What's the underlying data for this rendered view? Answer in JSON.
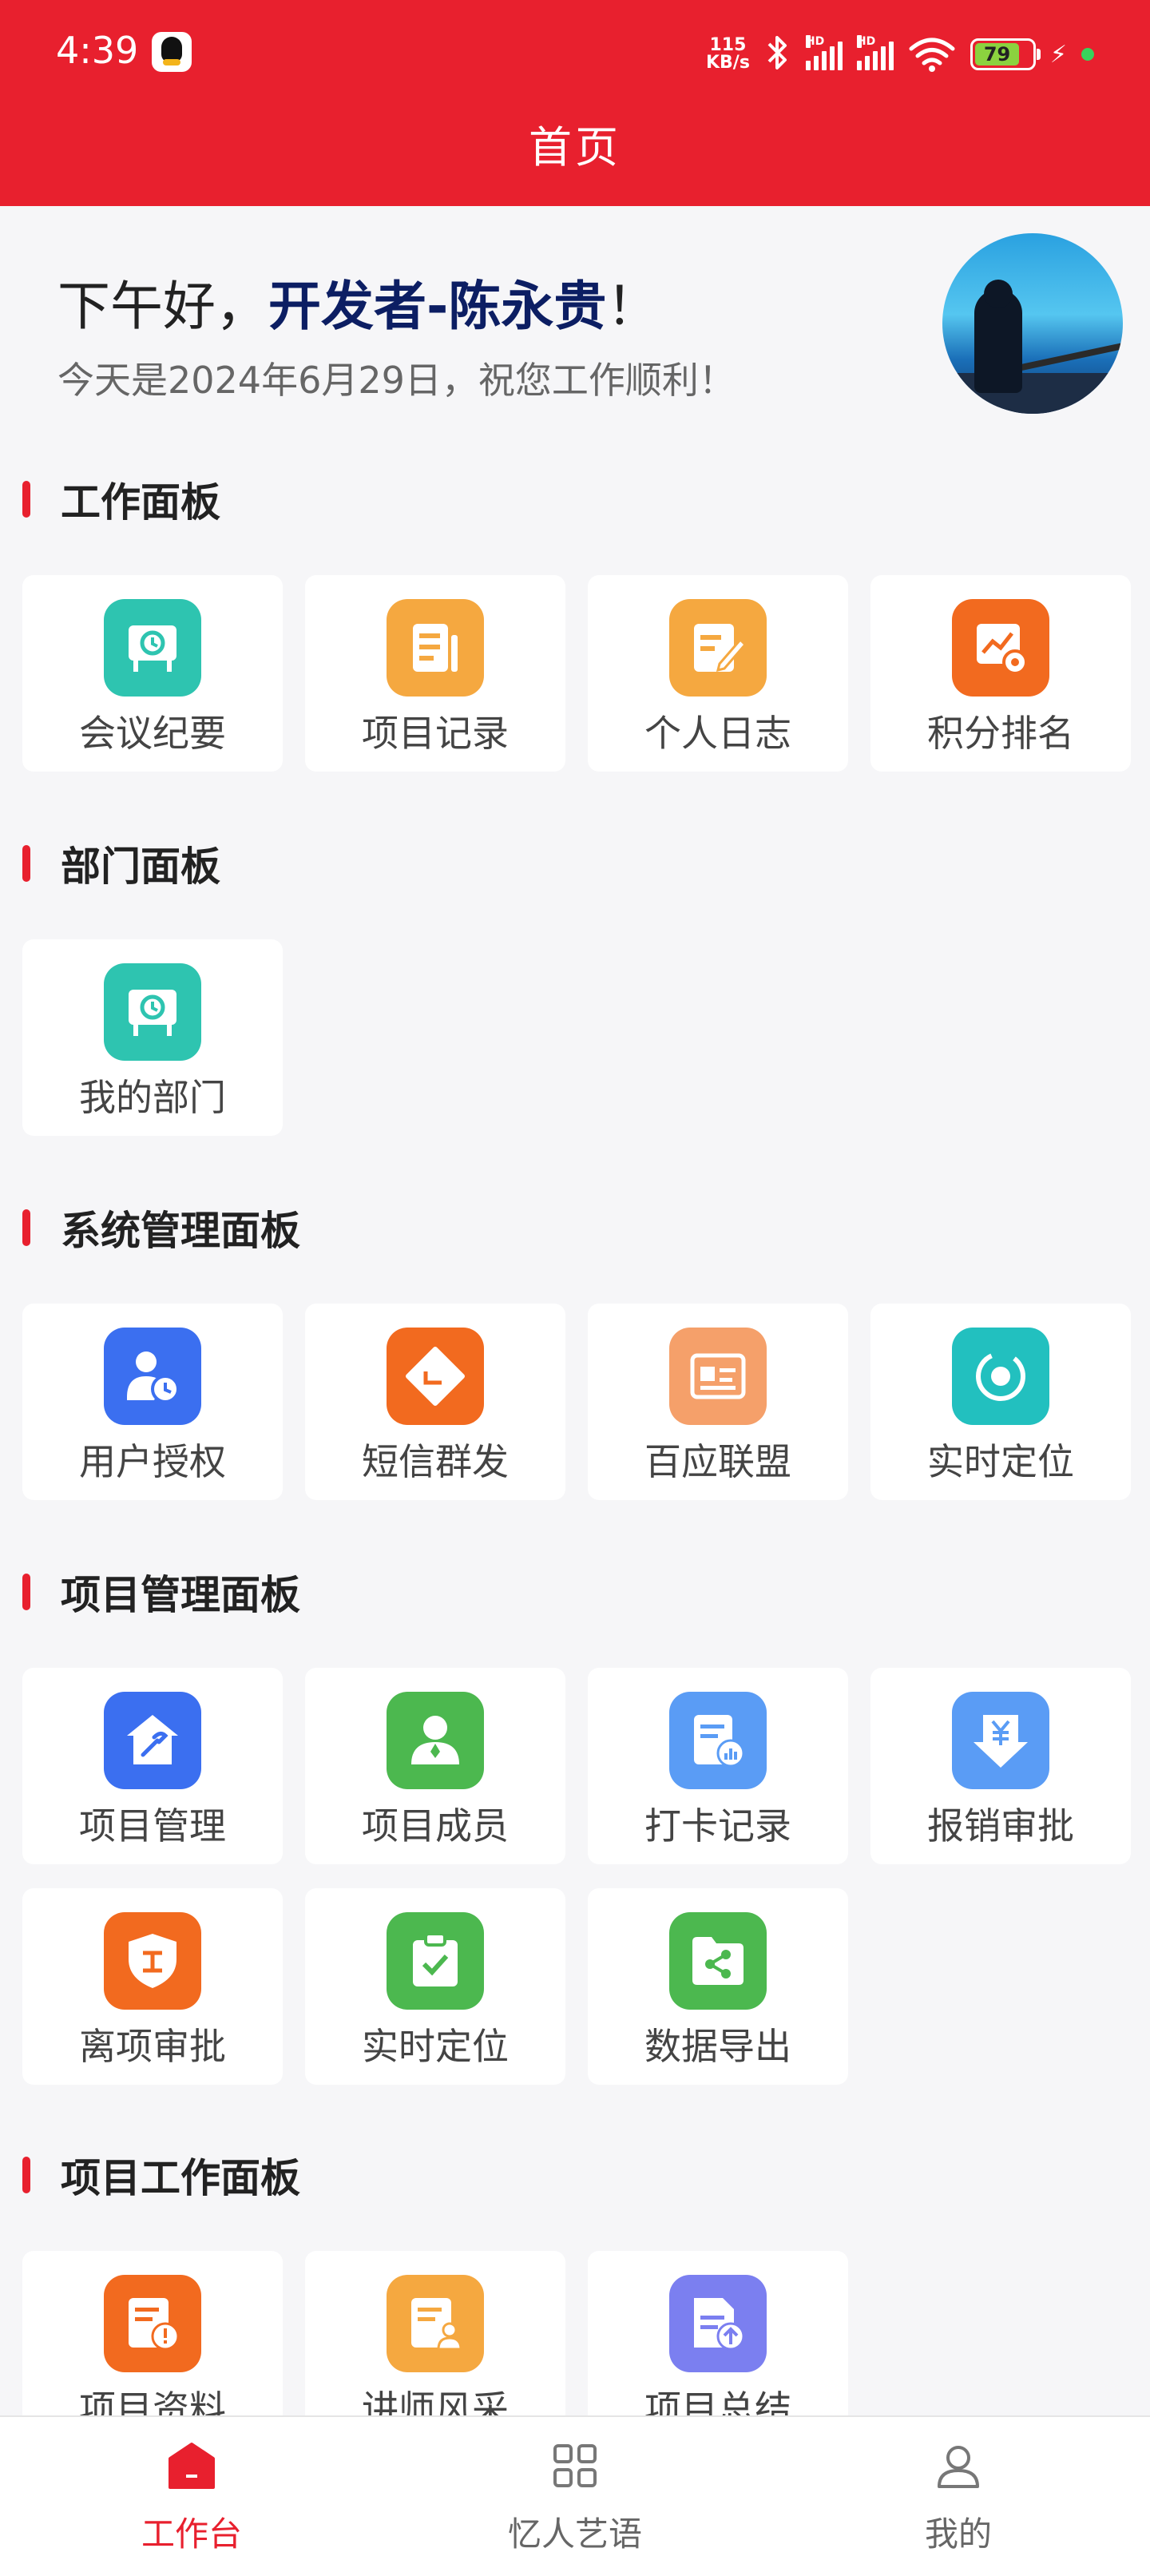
{
  "status_bar": {
    "time": "4:39",
    "net_speed_value": "115",
    "net_speed_unit": "KB/s",
    "signal_label": "HD",
    "battery_level": "79"
  },
  "header": {
    "title": "首页"
  },
  "greeting": {
    "salutation": "下午好，",
    "user_name": "开发者-陈永贵",
    "exclaim": "！",
    "date_line": "今天是2024年6月29日，祝您工作顺利！"
  },
  "sections": [
    {
      "title": "工作面板",
      "items": [
        {
          "label": "会议纪要",
          "icon": "meeting-board-icon",
          "color": "#2ec4b0"
        },
        {
          "label": "项目记录",
          "icon": "document-icon",
          "color": "#f5a840"
        },
        {
          "label": "个人日志",
          "icon": "edit-note-icon",
          "color": "#f5a840"
        },
        {
          "label": "积分排名",
          "icon": "chart-settings-icon",
          "color": "#f26a1f"
        }
      ]
    },
    {
      "title": "部门面板",
      "items": [
        {
          "label": "我的部门",
          "icon": "meeting-board-icon",
          "color": "#2ec4b0"
        }
      ]
    },
    {
      "title": "系统管理面板",
      "items": [
        {
          "label": "用户授权",
          "icon": "user-clock-icon",
          "color": "#3b6ff0"
        },
        {
          "label": "短信群发",
          "icon": "tag-icon",
          "color": "#f26a1f"
        },
        {
          "label": "百应联盟",
          "icon": "id-card-icon",
          "color": "#f5a06a"
        },
        {
          "label": "实时定位",
          "icon": "target-icon",
          "color": "#22c0bf"
        }
      ]
    },
    {
      "title": "项目管理面板",
      "items": [
        {
          "label": "项目管理",
          "icon": "house-tool-icon",
          "color": "#3b6ff0"
        },
        {
          "label": "项目成员",
          "icon": "member-icon",
          "color": "#4cb84f"
        },
        {
          "label": "打卡记录",
          "icon": "record-chart-icon",
          "color": "#5a9cf5"
        },
        {
          "label": "报销审批",
          "icon": "yuan-download-icon",
          "color": "#5a9cf5"
        },
        {
          "label": "离项审批",
          "icon": "shield-icon",
          "color": "#f26a1f"
        },
        {
          "label": "实时定位",
          "icon": "clipboard-check-icon",
          "color": "#4cb84f"
        },
        {
          "label": "数据导出",
          "icon": "share-folder-icon",
          "color": "#4cb84f"
        }
      ]
    },
    {
      "title": "项目工作面板",
      "items": [
        {
          "label": "项目资料",
          "icon": "doc-alert-icon",
          "color": "#f26a1f"
        },
        {
          "label": "讲师风采",
          "icon": "doc-person-icon",
          "color": "#f5a840"
        },
        {
          "label": "项目总结",
          "icon": "doc-upload-icon",
          "color": "#7b7ff0"
        }
      ]
    }
  ],
  "bottom_nav": [
    {
      "label": "工作台",
      "icon": "home-icon",
      "active": true
    },
    {
      "label": "忆人艺语",
      "icon": "grid-icon",
      "active": false
    },
    {
      "label": "我的",
      "icon": "user-icon",
      "active": false
    }
  ],
  "colors": {
    "brand": "#e8202e",
    "nav_active": "#e8202e"
  }
}
